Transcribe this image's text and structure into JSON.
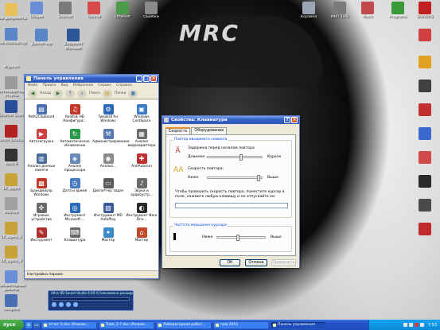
{
  "desktop": {
    "wallpaper_text": "MRC",
    "icons_left": [
      {
        "label": "Мои документы",
        "color": "#e8c15a"
      },
      {
        "label": "Мой компьютер",
        "color": "#5a87c9"
      },
      {
        "label": "Журнал",
        "color": "#c9c9c9"
      },
      {
        "label": "нестандартные отчеты",
        "color": "#9a9a9a"
      },
      {
        "label": "Brother Scan",
        "color": "#2a4d9a"
      },
      {
        "label": "Canon Solution",
        "color": "#b22222"
      },
      {
        "label": "Nero 9",
        "color": "#333333"
      },
      {
        "label": "1K_agora",
        "color": "#c9a23a"
      },
      {
        "label": "Archive",
        "color": "#a0a0a0"
      },
      {
        "label": "1K_agora_2",
        "color": "#c9a23a"
      },
      {
        "label": "1K_agora_3",
        "color": "#c9a23a"
      },
      {
        "label": "Лабораторные работы",
        "color": "#6a8fd8"
      },
      {
        "label": "nexgene",
        "color": "#4a6fb0"
      }
    ],
    "icons_top": [
      {
        "label": "Общие",
        "color": "#6a8fd8"
      },
      {
        "label": "Scanner",
        "color": "#7a7a7a"
      },
      {
        "label": "Tutorial",
        "color": "#d94a4a"
      },
      {
        "label": "Ethernet",
        "color": "#4a9a4a"
      },
      {
        "label": "Ошибки",
        "color": "#8a8a8a"
      }
    ],
    "icons_top2": [
      {
        "label": "Диспетчер",
        "color": "#5a87c9"
      },
      {
        "label": "Документ Microsoft",
        "color": "#2b579a"
      }
    ],
    "icons_right": [
      {
        "label": "Корзина",
        "color": "#9aa6b5"
      },
      {
        "label": "МВП 11-0",
        "color": "#7a7a7a"
      },
      {
        "label": "Music",
        "color": "#c04a4a"
      },
      {
        "label": "Programs",
        "color": "#3a9a3a"
      },
      {
        "label": "DRIVERS",
        "color": "#c02020"
      },
      {
        "label": "",
        "color": "#d04040"
      },
      {
        "label": "",
        "color": "#e0a020"
      },
      {
        "label": "",
        "color": "#404040"
      },
      {
        "label": "",
        "color": "#c03030"
      },
      {
        "label": "",
        "color": "#3a6ad0"
      },
      {
        "label": "",
        "color": "#d04a4a"
      },
      {
        "label": "",
        "color": "#2a2a2a"
      },
      {
        "label": "",
        "color": "#4a4a4a"
      },
      {
        "label": "",
        "color": "#c02a2a"
      }
    ]
  },
  "control_panel": {
    "title": "Панель управления",
    "menu": [
      "Файл",
      "Правка",
      "Вид",
      "Избранное",
      "Сервис",
      "Справка"
    ],
    "toolbar": {
      "back": "Назад",
      "search": "Поиск",
      "folders": "Папки",
      "switch_view": "Переключение к виду по категориям"
    },
    "items": [
      {
        "label": "Path2Clipboard",
        "color": "#4a6fb0",
        "glyph": "▤"
      },
      {
        "label": "Realtek HD Конфигура...",
        "color": "#c0392b",
        "glyph": "♫"
      },
      {
        "label": "TweakUI for Windows",
        "color": "#2a6ab8",
        "glyph": "⚙"
      },
      {
        "label": "Windows CardSpace",
        "color": "#3a7ac8",
        "glyph": "▣"
      },
      {
        "label": "Автозагрузка",
        "color": "#d04040",
        "glyph": "▶"
      },
      {
        "label": "Автоматическое обновление",
        "color": "#2a9a4a",
        "glyph": "↻"
      },
      {
        "label": "Администрирование",
        "color": "#5a7ab0",
        "glyph": "⚒"
      },
      {
        "label": "Анализ видеоадаптера",
        "color": "#6a6a6a",
        "glyph": "▦"
      },
      {
        "label": "Анализ данных памяти",
        "color": "#4a6a9a",
        "glyph": "▥"
      },
      {
        "label": "Анализ процессора",
        "color": "#6a8aba",
        "glyph": "◈"
      },
      {
        "label": "Анализ...",
        "color": "#8a8a8a",
        "glyph": "◉"
      },
      {
        "label": "AntiAutorun",
        "color": "#c03030",
        "glyph": "✚"
      },
      {
        "label": "Брандмауэр Windows",
        "color": "#c0392b",
        "glyph": "▩"
      },
      {
        "label": "Дата и время",
        "color": "#4a7ac0",
        "glyph": "◷"
      },
      {
        "label": "Диспетчер задач",
        "color": "#5a5a5a",
        "glyph": "▭"
      },
      {
        "label": "Звуки и аудиоустр...",
        "color": "#6a6a6a",
        "glyph": "♪"
      },
      {
        "label": "Игровые устройства",
        "color": "#6a6a6a",
        "glyph": "✜"
      },
      {
        "label": "Инструмент Microsoft ...",
        "color": "#2a6ab8",
        "glyph": "◎"
      },
      {
        "label": "Инструмент MD AutoPlay",
        "color": "#3a5a9a",
        "glyph": "▧"
      },
      {
        "label": "Инструмент Nero Driv...",
        "color": "#2a2a2a",
        "glyph": "◐"
      },
      {
        "label": "Инструмент",
        "color": "#b03030",
        "glyph": "✎"
      },
      {
        "label": "Клавиатура",
        "color": "#6a6a6a",
        "glyph": "⌨"
      },
      {
        "label": "Мастер",
        "color": "#3a8ac8",
        "glyph": "✦"
      },
      {
        "label": "Мастер",
        "color": "#c04a2a",
        "glyph": "⌂"
      }
    ],
    "status": "Настройка параме"
  },
  "keyboard_dialog": {
    "title": "Свойства: Клавиатура",
    "tabs": [
      "Скорость",
      "Оборудование"
    ],
    "group1": {
      "title": "Повтор вводимого символа",
      "delay_label": "Задержка перед началом повтора",
      "delay_left": "Длиннее",
      "delay_right": "Короче",
      "delay_value": 0.62,
      "rate_label": "Скорость повтора:",
      "rate_left": "Ниже",
      "rate_right": "Выше",
      "rate_value": 0.97,
      "test_hint": "Чтобы проверить скорость повтора, поместите курсор в поле, нажмите любую клавишу и не отпускайте ее:"
    },
    "group2": {
      "title": "Частота мерцания курсора",
      "left": "Ниже",
      "right": "Выше",
      "value": 0.42
    },
    "buttons": {
      "ok": "ОК",
      "cancel": "Отмена",
      "apply": "Применить"
    }
  },
  "player": {
    "title": "Ultra HD Sound Studio 6.00 (Стилизовано расширенным) 3-05.0"
  },
  "taskbar": {
    "start": "пуск",
    "tasks": [
      {
        "label": "отчет 5.doc (Режим...",
        "active": false
      },
      {
        "label": "Total_3-7.doc (Режим...",
        "active": false
      },
      {
        "label": "Лабораторная работ...",
        "active": false
      },
      {
        "label": "new 2011",
        "active": false
      },
      {
        "label": "Панель управления",
        "active": true
      }
    ],
    "clock": "7:53"
  }
}
